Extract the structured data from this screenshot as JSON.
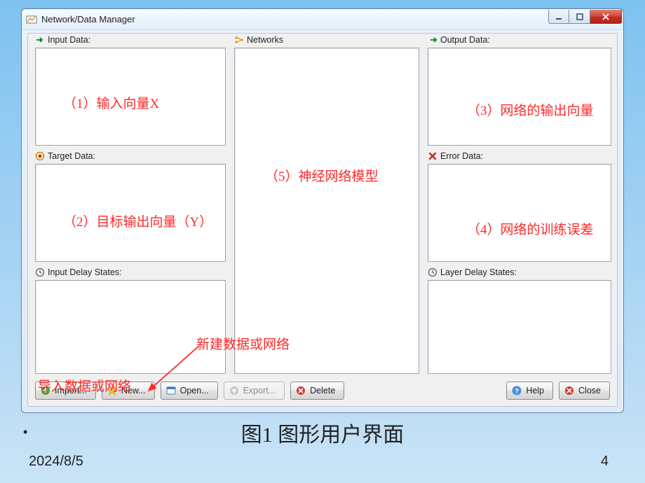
{
  "window": {
    "title": "Network/Data Manager"
  },
  "sections": {
    "input_data": "Input Data:",
    "target_data": "Target Data:",
    "input_delay": "Input Delay States:",
    "networks": "Networks",
    "output_data": "Output Data:",
    "error_data": "Error Data:",
    "layer_delay": "Layer Delay States:"
  },
  "buttons": {
    "import": "Import...",
    "new": "New...",
    "open": "Open...",
    "export": "Export...",
    "delete": "Delete",
    "help": "Help",
    "close": "Close"
  },
  "annotations": {
    "a1": "（1）输入向量X",
    "a2": "（2）目标输出向量（Y）",
    "a3": "（3）网络的输出向量",
    "a4": "（4）网络的训练误差",
    "a5": "（5）神经网络模型",
    "import_note": "导入数据或网络",
    "new_note": "新建数据或网络"
  },
  "caption": "图1 图形用户界面",
  "footer": {
    "date": "2024/8/5",
    "page": "4"
  }
}
